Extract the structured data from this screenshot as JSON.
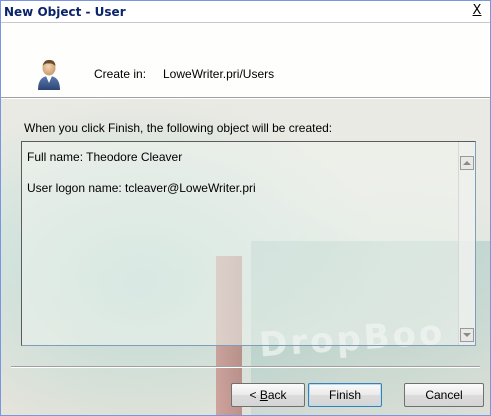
{
  "window": {
    "title": "New Object - User",
    "close_label": "X"
  },
  "header": {
    "icon": "user-icon",
    "create_in_label": "Create in:",
    "create_in_value": "LoweWriter.pri/Users"
  },
  "body": {
    "intro": "When you click Finish, the following object will be created:",
    "summary_lines": [
      "Full name: Theodore Cleaver",
      "User logon name: tcleaver@LoweWriter.pri"
    ]
  },
  "buttons": {
    "back_prefix": "< ",
    "back_mnemonic": "B",
    "back_rest": "ack",
    "finish": "Finish",
    "cancel": "Cancel"
  },
  "watermark": {
    "text": "DropBoo"
  }
}
